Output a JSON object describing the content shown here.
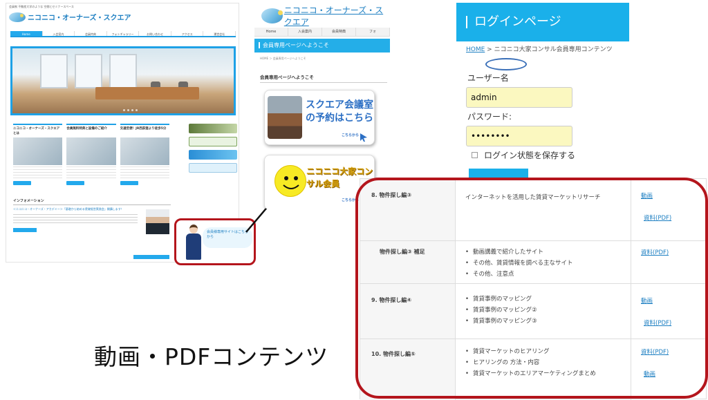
{
  "site": {
    "tagline": "会員制 不動産大学のような 空間とセミナースペース",
    "logo_text": "ニコニコ・オーナーズ・スクエア",
    "nav": [
      "Home",
      "入会案内",
      "会員特典",
      "フォトギャラリー",
      "お問い合わせ",
      "アクセス",
      "運営会社"
    ],
    "cards": [
      {
        "title": "ニコニコ・オーナーズ・スクエアとは"
      },
      {
        "title": "会員無料特典と設備のご紹介"
      },
      {
        "title": "交通至便！JR西荻窪より徒歩5分"
      }
    ],
    "info_heading": "インフォメーション",
    "info_link": "＜ニコニコ・オーナーズ・アカデミー＞「基礎から始める賃貸経営実践会」開講します！",
    "member_site_text": "会員様専用サイトはこちらから"
  },
  "members": {
    "logo_text": "ニコニコ・オーナーズ・スクエア",
    "nav": [
      "Home",
      "入会案内",
      "会員特典",
      "フォ"
    ],
    "bar_title": "会員専用ページへようこそ",
    "breadcrumb": "HOME ＞ 会員専用ページへようこそ",
    "heading": "会員専用ページへようこそ",
    "banner1_title": "スクエア会議室の予約はこちら",
    "banner1_small": "こちらから",
    "banner2_title": "ニコニコ大家コンサル会員",
    "banner2_small": "こちらから"
  },
  "login": {
    "title": "ログインページ",
    "crumb_home": "HOME",
    "crumb_rest": " > ニコニコ大家コンサル会員専用コンテンツ",
    "username_label": "ユーザー名",
    "username_value": "admin",
    "password_label": "パスワード:",
    "password_value": "••••••••",
    "remember_label": "ログイン状態を保存する"
  },
  "contents": {
    "rows": [
      {
        "title": "8. 物件探し編③",
        "plain": "インターネットを活用した賃貸マーケットリサーチ",
        "links": [
          "動画",
          "資料(PDF)"
        ]
      },
      {
        "title": "物件探し編③ 補足",
        "items": [
          "動画講義で紹介したサイト",
          "その他、賃貸情報を調べる主なサイト",
          "その他、注意点"
        ],
        "links": [
          "資料(PDF)"
        ]
      },
      {
        "title": "9. 物件探し編④",
        "items": [
          "賃貸事例のマッピング",
          "賃貸事例のマッピング②",
          "賃貸事例のマッピング③"
        ],
        "links": [
          "動画",
          "資料(PDF)"
        ]
      },
      {
        "title": "10. 物件探し編⑤",
        "items": [
          "賃貸マーケットのヒアリング",
          "ヒアリングの 方法・内容",
          "賃貸マーケットのエリアマーケティングまとめ"
        ],
        "links": [
          "資料(PDF)",
          "動画"
        ]
      }
    ]
  },
  "caption": "動画・PDFコンテンツ",
  "colors": {
    "accent": "#1ab0ea",
    "highlight": "#b4151c",
    "link": "#1d7fc2"
  }
}
